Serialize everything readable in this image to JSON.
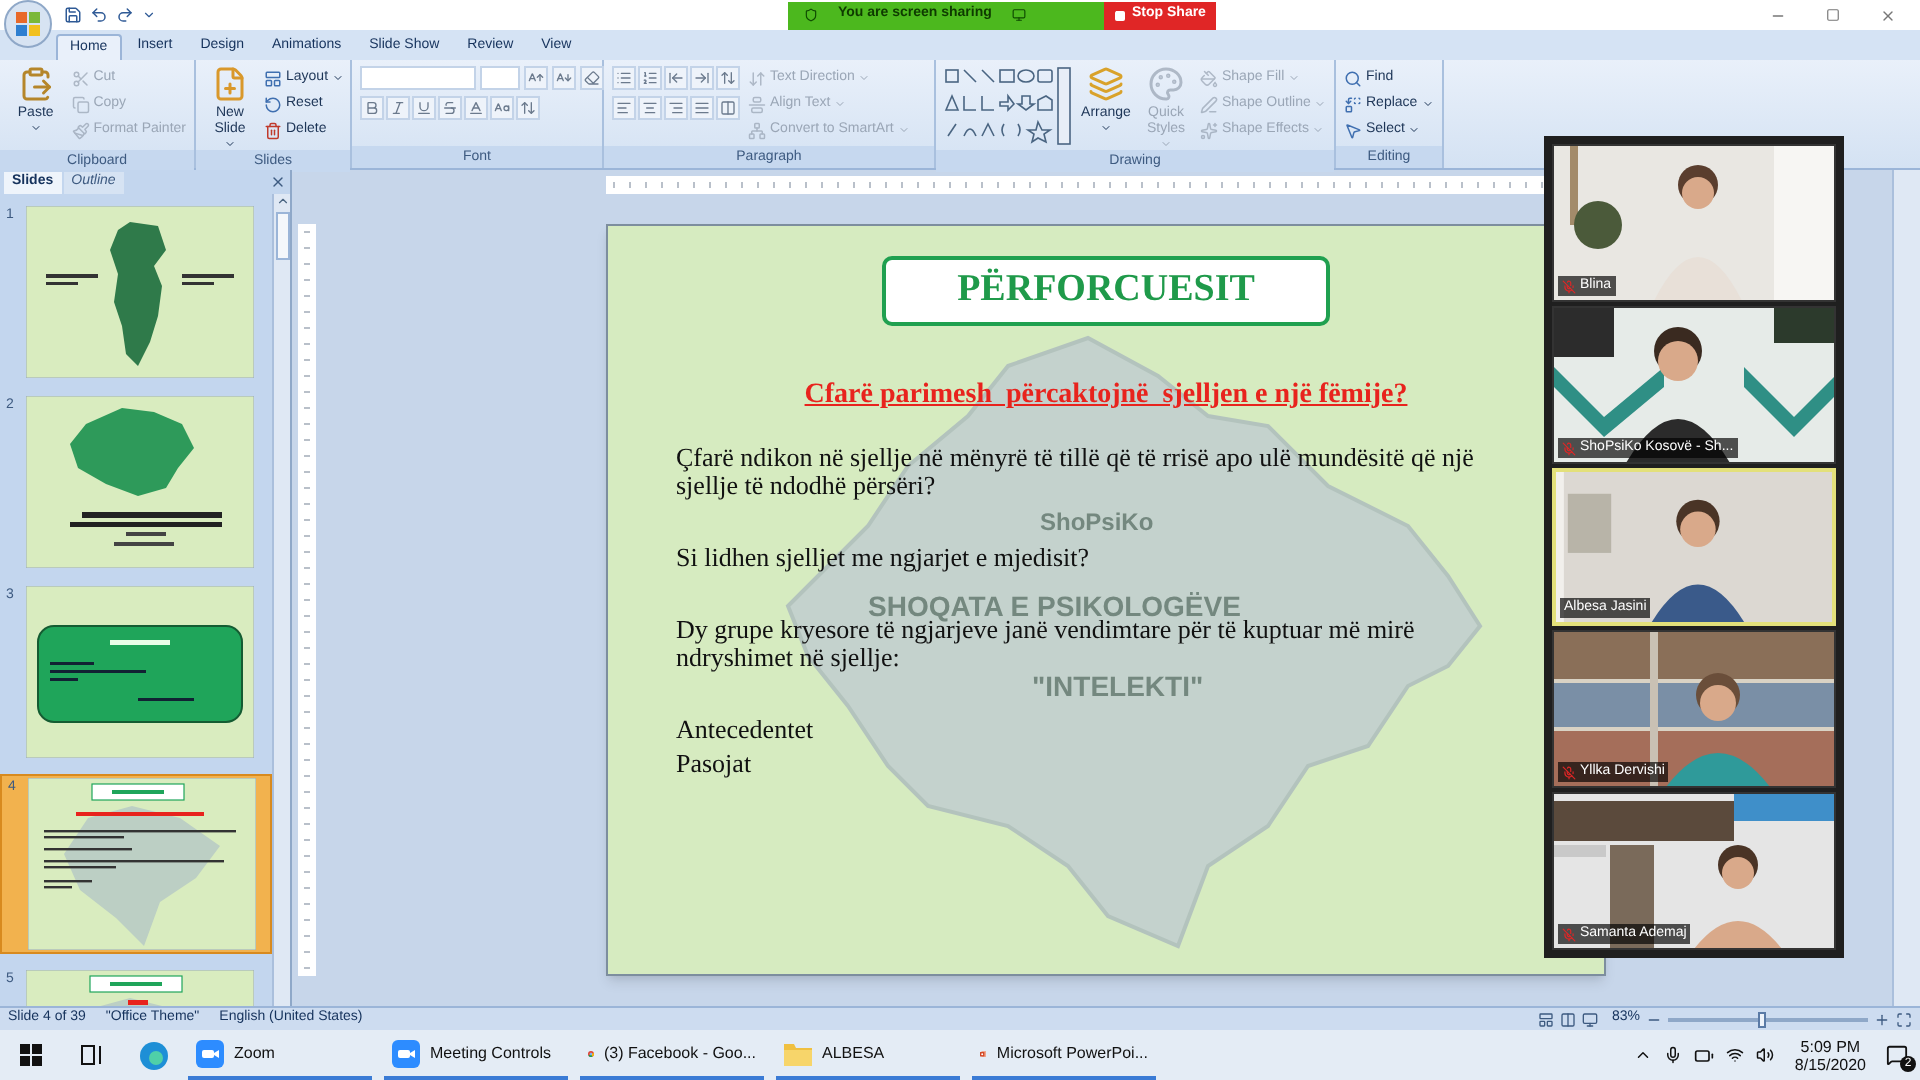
{
  "title_bar": {
    "share_status": "You are screen sharing",
    "stop_button": "Stop Share"
  },
  "ribbon": {
    "tabs": [
      {
        "label": "Home",
        "selected": true
      },
      {
        "label": "Insert",
        "selected": false
      },
      {
        "label": "Design",
        "selected": false
      },
      {
        "label": "Animations",
        "selected": false
      },
      {
        "label": "Slide Show",
        "selected": false
      },
      {
        "label": "Review",
        "selected": false
      },
      {
        "label": "View",
        "selected": false
      }
    ],
    "groups": [
      {
        "title": "Clipboard",
        "kind": "clipboard",
        "items": [
          {
            "label": "Paste",
            "kind": "paste",
            "disabled": false,
            "dropdown": true
          },
          {
            "label": "Cut",
            "kind": "cut",
            "disabled": true,
            "dropdown": false
          },
          {
            "label": "Copy",
            "kind": "copy",
            "disabled": true,
            "dropdown": false
          },
          {
            "label": "Format Painter",
            "kind": "format-painter",
            "disabled": true,
            "dropdown": false
          }
        ]
      },
      {
        "title": "Slides",
        "kind": "slides",
        "items": [
          {
            "label": "New Slide",
            "kind": "new-slide",
            "disabled": false,
            "dropdown": true
          },
          {
            "label": "Layout",
            "kind": "layout",
            "disabled": false,
            "dropdown": true
          },
          {
            "label": "Reset",
            "kind": "reset",
            "disabled": false,
            "dropdown": false
          },
          {
            "label": "Delete",
            "kind": "delete",
            "disabled": false,
            "dropdown": false
          }
        ]
      },
      {
        "title": "Font",
        "kind": "font"
      },
      {
        "title": "Paragraph",
        "kind": "paragraph",
        "items": [
          {
            "label": "Text Direction",
            "kind": "text-direction",
            "disabled": true,
            "dropdown": true
          },
          {
            "label": "Align Text",
            "kind": "align-text",
            "disabled": true,
            "dropdown": true
          },
          {
            "label": "Convert to SmartArt",
            "kind": "smartart",
            "disabled": true,
            "dropdown": true
          }
        ]
      },
      {
        "title": "Drawing",
        "kind": "drawing",
        "items": [
          {
            "label": "Arrange",
            "kind": "arrange",
            "disabled": false,
            "dropdown": true
          },
          {
            "label": "Quick Styles",
            "kind": "quick-styles",
            "disabled": true,
            "dropdown": true
          },
          {
            "label": "Shape Fill",
            "kind": "shape-fill",
            "disabled": true,
            "dropdown": true
          },
          {
            "label": "Shape Outline",
            "kind": "shape-outline",
            "disabled": true,
            "dropdown": true
          },
          {
            "label": "Shape Effects",
            "kind": "shape-effects",
            "disabled": true,
            "dropdown": true
          }
        ]
      },
      {
        "title": "Editing",
        "kind": "editing",
        "items": [
          {
            "label": "Find",
            "kind": "find",
            "disabled": false,
            "dropdown": false
          },
          {
            "label": "Replace",
            "kind": "replace",
            "disabled": false,
            "dropdown": true
          },
          {
            "label": "Select",
            "kind": "select",
            "disabled": false,
            "dropdown": true
          }
        ]
      }
    ]
  },
  "slide_panel": {
    "tabs": [
      {
        "label": "Slides",
        "selected": true
      },
      {
        "label": "Outline",
        "selected": false
      }
    ],
    "thumbnails": [
      {
        "number": "1",
        "kind": "map-dark",
        "selected": false
      },
      {
        "number": "2",
        "kind": "map",
        "selected": false
      },
      {
        "number": "3",
        "kind": "title-box",
        "selected": false
      },
      {
        "number": "4",
        "kind": "text",
        "selected": true
      },
      {
        "number": "5",
        "kind": "title",
        "selected": false
      }
    ]
  },
  "slide": {
    "title": "PËRFORCUESIT",
    "question": "Cfarë parimesh  përcaktojnë  sjelljen e një fëmije?",
    "background_texts": [
      "ShoPsiKo",
      "SHOQATA E PSIKOLOGËVE",
      "\"INTELEKTI\""
    ],
    "paragraphs": [
      "Çfarë ndikon në sjellje në mënyrë të tillë që të rrisë apo ulë mundësitë që një sjellje të ndodhë përsëri?",
      "Si lidhen sjelljet me ngjarjet e mjedisit?",
      "Dy grupe kryesore të ngjarjeve janë vendimtare për të kuptuar më mirë ndryshimet në sjellje:"
    ],
    "list": [
      "Antecedentet",
      "Pasojat"
    ]
  },
  "video_gallery": [
    {
      "name": "Blina",
      "active": false,
      "muted": true
    },
    {
      "name": "ShoPsiKo Kosovë - Sh...",
      "active": false,
      "muted": true
    },
    {
      "name": "Albesa Jasini",
      "active": true,
      "muted": false
    },
    {
      "name": "Yllka Dervishi",
      "active": false,
      "muted": true
    },
    {
      "name": "Samanta Ademaj",
      "active": false,
      "muted": true
    }
  ],
  "status_bar": {
    "slide": "Slide 4 of 39",
    "theme": "\"Office Theme\"",
    "language": "English (United States)",
    "zoom": {
      "reading": "83%",
      "level": 0.45
    }
  },
  "taskbar": {
    "apps": [
      {
        "label": "Zoom",
        "kind": "zoom"
      },
      {
        "label": "Meeting Controls",
        "kind": "zoom"
      },
      {
        "label": "(3) Facebook - Goo...",
        "kind": "chrome"
      },
      {
        "label": "ALBESA",
        "kind": "folder"
      },
      {
        "label": "Microsoft PowerPoi...",
        "kind": "powerpoint"
      }
    ],
    "time": "5:09 PM",
    "date": "8/15/2020",
    "notifications": "2"
  }
}
